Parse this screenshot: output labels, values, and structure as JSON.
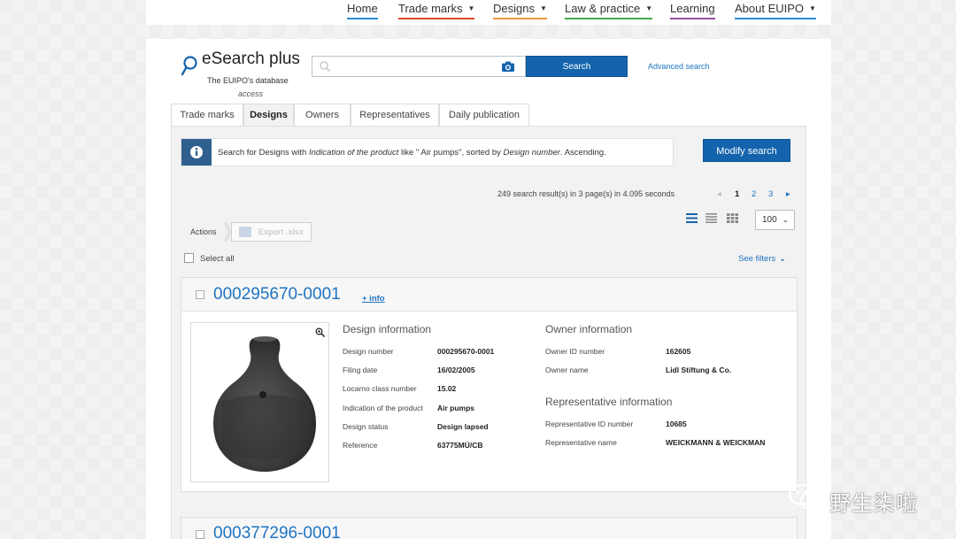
{
  "nav": {
    "items": [
      {
        "label": "Home",
        "dropdown": false,
        "underline": "#2a8bd6"
      },
      {
        "label": "Trade marks",
        "dropdown": true,
        "underline": "#d94b2b"
      },
      {
        "label": "Designs",
        "dropdown": true,
        "underline": "#e69a3c"
      },
      {
        "label": "Law & practice",
        "dropdown": true,
        "underline": "#4aa84a"
      },
      {
        "label": "Learning",
        "dropdown": false,
        "underline": "#9b4aa8"
      },
      {
        "label": "About EUIPO",
        "dropdown": true,
        "underline": "#2a8bd6"
      }
    ]
  },
  "logo": {
    "title": "eSearch plus",
    "subtitle": "The EUIPO's database",
    "subtitle2": "access"
  },
  "search": {
    "value": "",
    "placeholder": "",
    "button_label": "Search",
    "advanced_label": "Advanced search"
  },
  "tabs": [
    {
      "label": "Trade marks",
      "active": false
    },
    {
      "label": "Designs",
      "active": true
    },
    {
      "label": "Owners",
      "active": false
    },
    {
      "label": "Representatives",
      "active": false
    },
    {
      "label": "Daily publication",
      "active": false
    }
  ],
  "info": {
    "prefix": "Search for Designs with ",
    "field": "Indication of the product",
    "middle": " like \" Air pumps\", sorted by ",
    "sort_field": "Design number",
    "suffix": ". Ascending."
  },
  "modify_label": "Modify search",
  "results": {
    "summary": "249 search result(s) in 3 page(s) in 4.095 seconds",
    "pages": [
      "1",
      "2",
      "3"
    ],
    "current_page": "1",
    "per_page": "100"
  },
  "actions": {
    "label": "Actions",
    "export_label": "Export .xlsx",
    "select_all": "Select all",
    "see_filters": "See filters"
  },
  "design": {
    "number": "000295670-0001",
    "more_info": "+ info",
    "design_section": "Design information",
    "design_fields": [
      {
        "label": "Design number",
        "value": "000295670-0001"
      },
      {
        "label": "Filing date",
        "value": "16/02/2005"
      },
      {
        "label": "Locarno class number",
        "value": "15.02"
      },
      {
        "label": "Indication of the product",
        "value": "Air pumps"
      },
      {
        "label": "Design status",
        "value": "Design lapsed"
      },
      {
        "label": "Reference",
        "value": "63775MÜ/CB"
      }
    ],
    "owner_section": "Owner information",
    "owner_fields": [
      {
        "label": "Owner ID number",
        "value": "162605"
      },
      {
        "label": "Owner name",
        "value": "Lidl Stiftung & Co."
      }
    ],
    "rep_section": "Representative information",
    "rep_fields": [
      {
        "label": "Representative ID number",
        "value": "10685"
      },
      {
        "label": "Representative name",
        "value": "WEICKMANN & WEICKMAN"
      }
    ]
  },
  "next_design": {
    "number": "000377296-0001"
  },
  "watermark": "野生柒啦",
  "colors": {
    "primary": "#1464ad",
    "link": "#1f74c3",
    "info_box": "#2f5f8c"
  }
}
